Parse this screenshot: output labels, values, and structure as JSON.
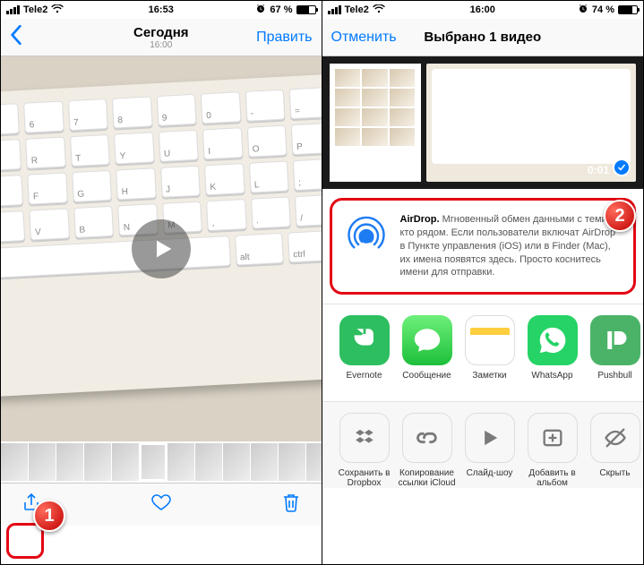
{
  "left": {
    "status": {
      "carrier": "Tele2",
      "time": "16:53",
      "battery_pct": "67 %",
      "battery_fill": 67,
      "alarm": true
    },
    "nav": {
      "title": "Сегодня",
      "subtitle": "16:00",
      "back_icon": "chevron-left",
      "edit": "Править"
    },
    "toolbar": {
      "share": "share-icon",
      "like": "heart-icon",
      "trash": "trash-icon"
    },
    "step_badge": "1"
  },
  "right": {
    "status": {
      "carrier": "Tele2",
      "time": "16:00",
      "battery_pct": "74 %",
      "battery_fill": 74,
      "alarm": true
    },
    "nav": {
      "cancel": "Отменить",
      "title": "Выбрано 1 видео"
    },
    "selected_duration": "0:01",
    "airdrop": {
      "title": "AirDrop.",
      "body": "Мгновенный обмен данными с теми, кто рядом. Если пользователи включат AirDrop в Пункте управления (iOS) или в Finder (Mac), их имена появятся здесь. Просто коснитесь имени для отправки."
    },
    "apps": [
      {
        "name": "Evernote",
        "color": "#2dbe60",
        "icon": "evernote"
      },
      {
        "name": "Сообщение",
        "color": "#4cd964",
        "icon": "message"
      },
      {
        "name": "Заметки",
        "color": "#ffffff",
        "icon": "notes"
      },
      {
        "name": "WhatsApp",
        "color": "#25d366",
        "icon": "whatsapp"
      },
      {
        "name": "Pushbull",
        "color": "#4ab367",
        "icon": "pushbullet"
      }
    ],
    "actions": [
      {
        "name": "Сохранить в Dropbox",
        "icon": "dropbox"
      },
      {
        "name": "Копирование ссылки iCloud",
        "icon": "link"
      },
      {
        "name": "Слайд-шоу",
        "icon": "play"
      },
      {
        "name": "Добавить в альбом",
        "icon": "add-album"
      },
      {
        "name": "Скрыть",
        "icon": "hide"
      }
    ],
    "step_badge": "2"
  }
}
